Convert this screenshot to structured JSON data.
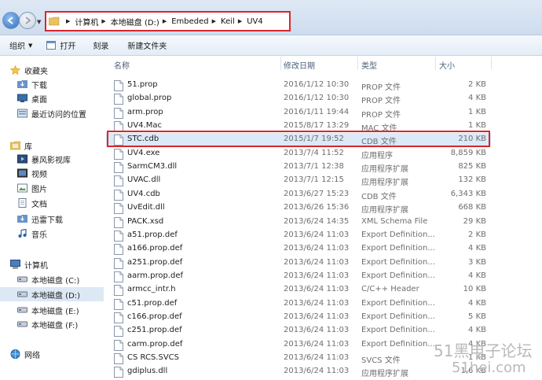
{
  "address_bar": {
    "crumbs": [
      "计算机",
      "本地磁盘 (D:)",
      "Embeded",
      "Keil",
      "UV4"
    ]
  },
  "toolbar": {
    "organize": "组织",
    "open": "打开",
    "burn": "刻录",
    "new_folder": "新建文件夹"
  },
  "nav": {
    "favorites": {
      "title": "收藏夹",
      "items": [
        "下载",
        "桌面",
        "最近访问的位置"
      ]
    },
    "libraries": {
      "title": "库",
      "items": [
        "暴风影视库",
        "视频",
        "图片",
        "文档",
        "迅雷下载",
        "音乐"
      ]
    },
    "computer": {
      "title": "计算机",
      "items": [
        "本地磁盘 (C:)",
        "本地磁盘 (D:)",
        "本地磁盘 (E:)",
        "本地磁盘 (F:)"
      ]
    },
    "network": {
      "title": "网络"
    }
  },
  "columns": {
    "name": "名称",
    "date": "修改日期",
    "type": "类型",
    "size": "大小"
  },
  "files": [
    {
      "name": "51.prop",
      "date": "2016/1/12 10:30",
      "type": "PROP 文件",
      "size": "2 KB"
    },
    {
      "name": "global.prop",
      "date": "2016/1/12 10:30",
      "type": "PROP 文件",
      "size": "4 KB"
    },
    {
      "name": "arm.prop",
      "date": "2016/1/11 19:44",
      "type": "PROP 文件",
      "size": "1 KB"
    },
    {
      "name": "UV4.Mac",
      "date": "2015/8/17 13:29",
      "type": "MAC 文件",
      "size": "1 KB"
    },
    {
      "name": "STC.cdb",
      "date": "2015/1/7 19:52",
      "type": "CDB 文件",
      "size": "210 KB"
    },
    {
      "name": "UV4.exe",
      "date": "2013/7/4 11:52",
      "type": "应用程序",
      "size": "8,859 KB"
    },
    {
      "name": "SarmCM3.dll",
      "date": "2013/7/1 12:38",
      "type": "应用程序扩展",
      "size": "825 KB"
    },
    {
      "name": "UVAC.dll",
      "date": "2013/7/1 12:15",
      "type": "应用程序扩展",
      "size": "132 KB"
    },
    {
      "name": "UV4.cdb",
      "date": "2013/6/27 15:23",
      "type": "CDB 文件",
      "size": "6,343 KB"
    },
    {
      "name": "UvEdit.dll",
      "date": "2013/6/26 15:36",
      "type": "应用程序扩展",
      "size": "668 KB"
    },
    {
      "name": "PACK.xsd",
      "date": "2013/6/24 14:35",
      "type": "XML Schema File",
      "size": "29 KB"
    },
    {
      "name": "a51.prop.def",
      "date": "2013/6/24 11:03",
      "type": "Export Definition...",
      "size": "2 KB"
    },
    {
      "name": "a166.prop.def",
      "date": "2013/6/24 11:03",
      "type": "Export Definition...",
      "size": "4 KB"
    },
    {
      "name": "a251.prop.def",
      "date": "2013/6/24 11:03",
      "type": "Export Definition...",
      "size": "3 KB"
    },
    {
      "name": "aarm.prop.def",
      "date": "2013/6/24 11:03",
      "type": "Export Definition...",
      "size": "4 KB"
    },
    {
      "name": "armcc_intr.h",
      "date": "2013/6/24 11:03",
      "type": "C/C++ Header",
      "size": "10 KB"
    },
    {
      "name": "c51.prop.def",
      "date": "2013/6/24 11:03",
      "type": "Export Definition...",
      "size": "4 KB"
    },
    {
      "name": "c166.prop.def",
      "date": "2013/6/24 11:03",
      "type": "Export Definition...",
      "size": "5 KB"
    },
    {
      "name": "c251.prop.def",
      "date": "2013/6/24 11:03",
      "type": "Export Definition...",
      "size": "4 KB"
    },
    {
      "name": "carm.prop.def",
      "date": "2013/6/24 11:03",
      "type": "Export Definition...",
      "size": "4 KB"
    },
    {
      "name": "CS RCS.SVCS",
      "date": "2013/6/24 11:03",
      "type": "SVCS 文件",
      "size": "1 KB"
    },
    {
      "name": "gdiplus.dll",
      "date": "2013/6/24 11:03",
      "type": "应用程序扩展",
      "size": "1,6 KB"
    }
  ],
  "selected_file": "STC.cdb",
  "watermark": {
    "line1": "51黑电子论坛",
    "line2": "51hei.com"
  },
  "colors": {
    "highlight_border": "#d8262e",
    "selection": "#dbe9f8"
  }
}
